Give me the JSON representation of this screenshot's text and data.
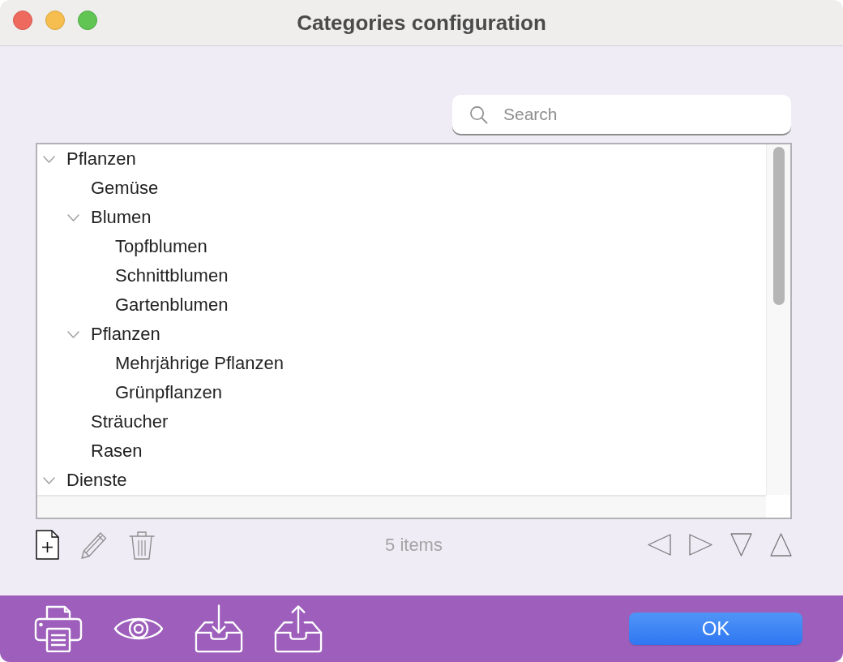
{
  "window": {
    "title": "Categories configuration"
  },
  "search": {
    "placeholder": "Search"
  },
  "tree": {
    "items": [
      {
        "label": "Pflanzen",
        "expanded": true,
        "children": [
          {
            "label": "Gemüse"
          },
          {
            "label": "Blumen",
            "expanded": true,
            "children": [
              {
                "label": "Topfblumen"
              },
              {
                "label": "Schnittblumen"
              },
              {
                "label": "Gartenblumen"
              }
            ]
          },
          {
            "label": "Pflanzen",
            "expanded": true,
            "children": [
              {
                "label": "Mehrjährige Pflanzen"
              },
              {
                "label": "Grünpflanzen"
              }
            ]
          },
          {
            "label": "Sträucher"
          },
          {
            "label": "Rasen"
          }
        ]
      },
      {
        "label": "Dienste",
        "expanded": true
      }
    ]
  },
  "item_count": "5 items",
  "buttons": [
    {
      "label": "OK"
    }
  ]
}
